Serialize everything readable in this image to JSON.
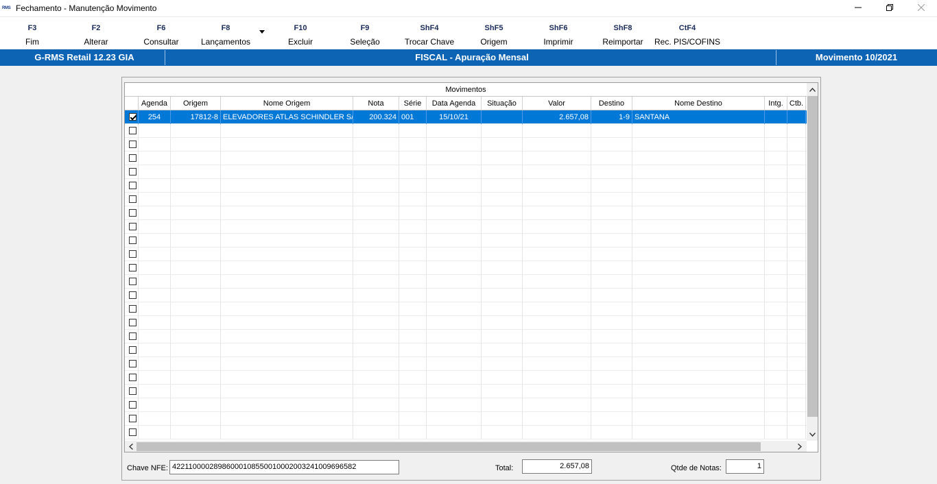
{
  "window": {
    "logo": "RMS",
    "title": "Fechamento - Manutenção Movimento"
  },
  "toolbar": [
    {
      "key": "F3",
      "label": "Fim"
    },
    {
      "key": "F2",
      "label": "Alterar"
    },
    {
      "key": "F6",
      "label": "Consultar"
    },
    {
      "key": "F8",
      "label": "Lançamentos"
    },
    {
      "key": "F10",
      "label": "Excluir"
    },
    {
      "key": "F9",
      "label": "Seleção"
    },
    {
      "key": "ShF4",
      "label": "Trocar Chave"
    },
    {
      "key": "ShF5",
      "label": "Origem"
    },
    {
      "key": "ShF6",
      "label": "Imprimir"
    },
    {
      "key": "ShF8",
      "label": "Reimportar"
    },
    {
      "key": "CtF4",
      "label": "Rec. PIS/COFINS"
    }
  ],
  "infobar": {
    "left": "G-RMS Retail 12.23 GIA",
    "center": "FISCAL - Apuração Mensal",
    "right": "Movimento 10/2021"
  },
  "grid": {
    "group_title": "Movimentos",
    "columns": [
      "Agenda",
      "Origem",
      "Nome Origem",
      "Nota",
      "Série",
      "Data Agenda",
      "Situação",
      "Valor",
      "Destino",
      "Nome Destino",
      "Intg.",
      "Ctb."
    ],
    "rows": [
      {
        "checked": true,
        "agenda": "254",
        "origem": "17812-8",
        "nome_origem": "ELEVADORES ATLAS SCHINDLER S/A",
        "nota": "200.324",
        "serie": "001",
        "data_agenda": "15/10/21",
        "situacao": "",
        "valor": "2.657,08",
        "destino": "1-9",
        "nome_destino": "SANTANA",
        "intg": "",
        "ctb": ""
      }
    ],
    "empty_rows": 23,
    "colors": {
      "selection": "#0078d7",
      "header_bar": "#0e64b4"
    }
  },
  "footer": {
    "chave_label": "Chave NFE:",
    "chave_value": "42211000028986000108550010002003241009696582",
    "total_label": "Total:",
    "total_value": "2.657,08",
    "qtde_label": "Qtde de Notas:",
    "qtde_value": "1"
  }
}
